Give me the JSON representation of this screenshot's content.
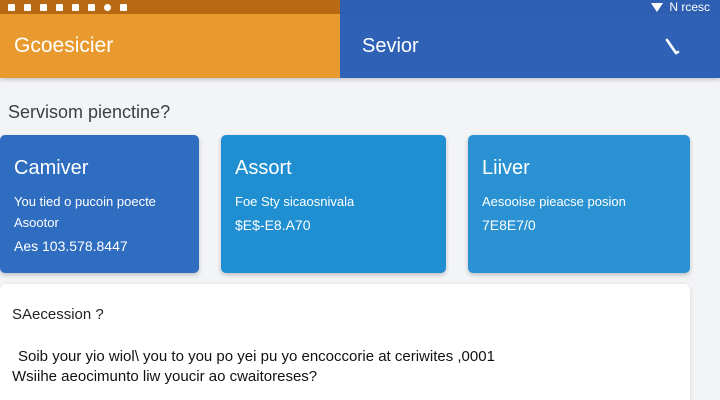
{
  "status_bar": {
    "left_icons": [
      "notification-icon",
      "notification-icon",
      "notification-icon",
      "notification-icon",
      "notification-icon",
      "notification-icon",
      "alarm-icon",
      "notification-icon"
    ],
    "right_text": "N rcesc",
    "signal_icon": "signal-icon",
    "colors": {
      "left": "#b86a12",
      "right": "#2f5fb3"
    }
  },
  "app_bar": {
    "title": "Gcoesicier",
    "subtitle": "Sevior",
    "action_icon": "edit-icon",
    "colors": {
      "left": "#e99a2e",
      "right": "#2f62b7"
    }
  },
  "main": {
    "question": "Servisom pienctine?",
    "cards": [
      {
        "title": "Camiver",
        "line1": "You tied o pucoin poecte",
        "line2": "Asootor",
        "value": "Aes 103.578.8447",
        "color": "#2f6dc0"
      },
      {
        "title": "Assort",
        "line1": "Foe Sty sicaosnivala",
        "line2": "",
        "value": "$E$-E8.A70",
        "color": "#1f8fd1"
      },
      {
        "title": "Liiver",
        "line1": "Aesooise pieacse posion",
        "line2": "",
        "value": "7E8E7/0",
        "color": "#2a92d2"
      }
    ]
  },
  "panel": {
    "title": "SAecession ?",
    "line1": "Soib your yio wiol\\ you to you po yei pu yo encoccorie at ceriwites ,0001",
    "line2": "Wsiihe aeocimunto liw youcir ao cwaitoreses?"
  }
}
